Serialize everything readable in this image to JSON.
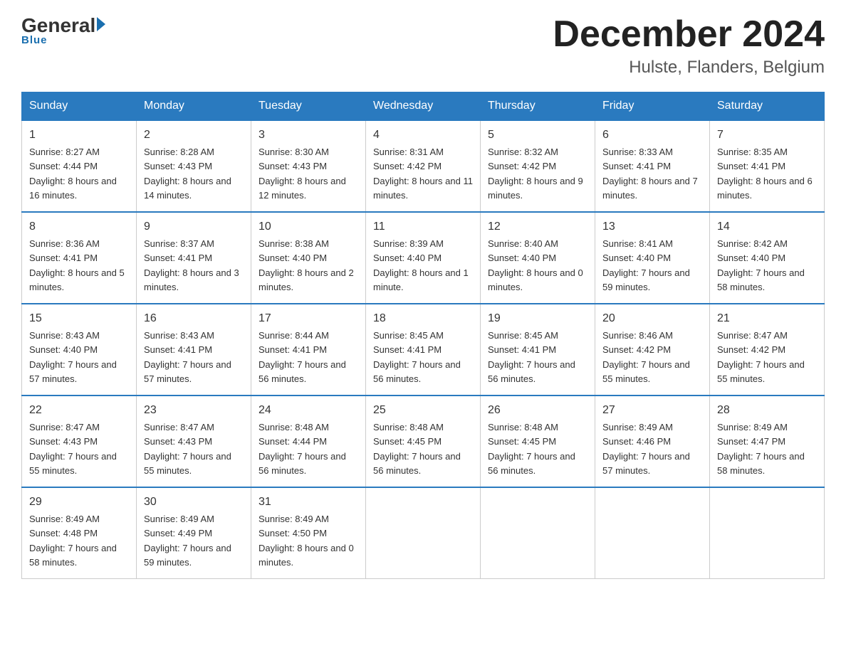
{
  "logo": {
    "general": "General",
    "blue_text": "Blue",
    "underline": "Blue"
  },
  "header": {
    "month_year": "December 2024",
    "location": "Hulste, Flanders, Belgium"
  },
  "days_of_week": [
    "Sunday",
    "Monday",
    "Tuesday",
    "Wednesday",
    "Thursday",
    "Friday",
    "Saturday"
  ],
  "weeks": [
    [
      {
        "num": "1",
        "sunrise": "8:27 AM",
        "sunset": "4:44 PM",
        "daylight": "8 hours and 16 minutes."
      },
      {
        "num": "2",
        "sunrise": "8:28 AM",
        "sunset": "4:43 PM",
        "daylight": "8 hours and 14 minutes."
      },
      {
        "num": "3",
        "sunrise": "8:30 AM",
        "sunset": "4:43 PM",
        "daylight": "8 hours and 12 minutes."
      },
      {
        "num": "4",
        "sunrise": "8:31 AM",
        "sunset": "4:42 PM",
        "daylight": "8 hours and 11 minutes."
      },
      {
        "num": "5",
        "sunrise": "8:32 AM",
        "sunset": "4:42 PM",
        "daylight": "8 hours and 9 minutes."
      },
      {
        "num": "6",
        "sunrise": "8:33 AM",
        "sunset": "4:41 PM",
        "daylight": "8 hours and 7 minutes."
      },
      {
        "num": "7",
        "sunrise": "8:35 AM",
        "sunset": "4:41 PM",
        "daylight": "8 hours and 6 minutes."
      }
    ],
    [
      {
        "num": "8",
        "sunrise": "8:36 AM",
        "sunset": "4:41 PM",
        "daylight": "8 hours and 5 minutes."
      },
      {
        "num": "9",
        "sunrise": "8:37 AM",
        "sunset": "4:41 PM",
        "daylight": "8 hours and 3 minutes."
      },
      {
        "num": "10",
        "sunrise": "8:38 AM",
        "sunset": "4:40 PM",
        "daylight": "8 hours and 2 minutes."
      },
      {
        "num": "11",
        "sunrise": "8:39 AM",
        "sunset": "4:40 PM",
        "daylight": "8 hours and 1 minute."
      },
      {
        "num": "12",
        "sunrise": "8:40 AM",
        "sunset": "4:40 PM",
        "daylight": "8 hours and 0 minutes."
      },
      {
        "num": "13",
        "sunrise": "8:41 AM",
        "sunset": "4:40 PM",
        "daylight": "7 hours and 59 minutes."
      },
      {
        "num": "14",
        "sunrise": "8:42 AM",
        "sunset": "4:40 PM",
        "daylight": "7 hours and 58 minutes."
      }
    ],
    [
      {
        "num": "15",
        "sunrise": "8:43 AM",
        "sunset": "4:40 PM",
        "daylight": "7 hours and 57 minutes."
      },
      {
        "num": "16",
        "sunrise": "8:43 AM",
        "sunset": "4:41 PM",
        "daylight": "7 hours and 57 minutes."
      },
      {
        "num": "17",
        "sunrise": "8:44 AM",
        "sunset": "4:41 PM",
        "daylight": "7 hours and 56 minutes."
      },
      {
        "num": "18",
        "sunrise": "8:45 AM",
        "sunset": "4:41 PM",
        "daylight": "7 hours and 56 minutes."
      },
      {
        "num": "19",
        "sunrise": "8:45 AM",
        "sunset": "4:41 PM",
        "daylight": "7 hours and 56 minutes."
      },
      {
        "num": "20",
        "sunrise": "8:46 AM",
        "sunset": "4:42 PM",
        "daylight": "7 hours and 55 minutes."
      },
      {
        "num": "21",
        "sunrise": "8:47 AM",
        "sunset": "4:42 PM",
        "daylight": "7 hours and 55 minutes."
      }
    ],
    [
      {
        "num": "22",
        "sunrise": "8:47 AM",
        "sunset": "4:43 PM",
        "daylight": "7 hours and 55 minutes."
      },
      {
        "num": "23",
        "sunrise": "8:47 AM",
        "sunset": "4:43 PM",
        "daylight": "7 hours and 55 minutes."
      },
      {
        "num": "24",
        "sunrise": "8:48 AM",
        "sunset": "4:44 PM",
        "daylight": "7 hours and 56 minutes."
      },
      {
        "num": "25",
        "sunrise": "8:48 AM",
        "sunset": "4:45 PM",
        "daylight": "7 hours and 56 minutes."
      },
      {
        "num": "26",
        "sunrise": "8:48 AM",
        "sunset": "4:45 PM",
        "daylight": "7 hours and 56 minutes."
      },
      {
        "num": "27",
        "sunrise": "8:49 AM",
        "sunset": "4:46 PM",
        "daylight": "7 hours and 57 minutes."
      },
      {
        "num": "28",
        "sunrise": "8:49 AM",
        "sunset": "4:47 PM",
        "daylight": "7 hours and 58 minutes."
      }
    ],
    [
      {
        "num": "29",
        "sunrise": "8:49 AM",
        "sunset": "4:48 PM",
        "daylight": "7 hours and 58 minutes."
      },
      {
        "num": "30",
        "sunrise": "8:49 AM",
        "sunset": "4:49 PM",
        "daylight": "7 hours and 59 minutes."
      },
      {
        "num": "31",
        "sunrise": "8:49 AM",
        "sunset": "4:50 PM",
        "daylight": "8 hours and 0 minutes."
      },
      {
        "num": "",
        "sunrise": "",
        "sunset": "",
        "daylight": ""
      },
      {
        "num": "",
        "sunrise": "",
        "sunset": "",
        "daylight": ""
      },
      {
        "num": "",
        "sunrise": "",
        "sunset": "",
        "daylight": ""
      },
      {
        "num": "",
        "sunrise": "",
        "sunset": "",
        "daylight": ""
      }
    ]
  ],
  "labels": {
    "sunrise_prefix": "Sunrise: ",
    "sunset_prefix": "Sunset: ",
    "daylight_prefix": "Daylight: "
  }
}
